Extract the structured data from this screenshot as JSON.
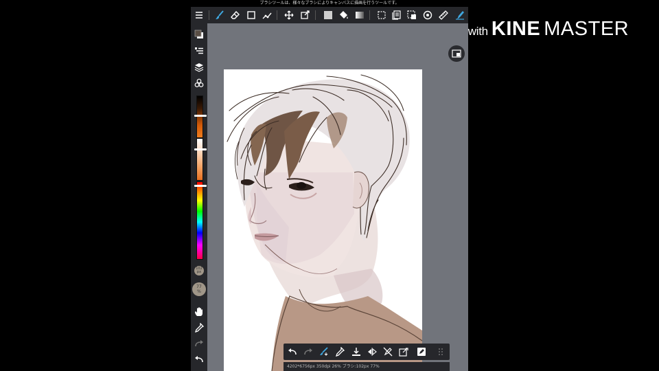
{
  "tooltip": "ブラシツールは、様々なブラシによりキャンバスに描画を行うツールです。",
  "watermark": {
    "prefix": "Made with",
    "brand_bold": "KINE",
    "brand_light": "MASTER"
  },
  "brush_size_badge": "102\npx",
  "opacity_badge": "77\n%",
  "status_text": "4202*6756px 350dpi 26% ブラシ:102px 77%",
  "colors": {
    "accent": "#3fa8e0",
    "toolbar_bg": "#26272b",
    "workspace_bg": "#71747b",
    "canvas_bg": "#ffffff"
  },
  "top_toolbar": [
    "menu-icon",
    "brush-icon",
    "eraser-icon",
    "rectangle-icon",
    "line-icon",
    "move-icon",
    "transform-icon",
    "fill-rect-icon",
    "bucket-icon",
    "gradient-icon",
    "lasso-select-icon",
    "copy-layer-icon",
    "select-icon",
    "rotate-icon",
    "ruler-icon",
    "pen-icon"
  ],
  "left_toolbar": [
    "color-swatch-icon",
    "brush-list-icon",
    "layers-icon",
    "materials-icon",
    "hand-icon",
    "eyedropper-icon",
    "redo-icon",
    "undo-icon"
  ],
  "bottom_toolbar": [
    "undo-icon",
    "redo-icon",
    "brush-snap-icon",
    "eyedropper-icon",
    "save-icon",
    "flip-icon",
    "no-snap-icon",
    "clear-icon",
    "edit-icon",
    "more-icon"
  ]
}
